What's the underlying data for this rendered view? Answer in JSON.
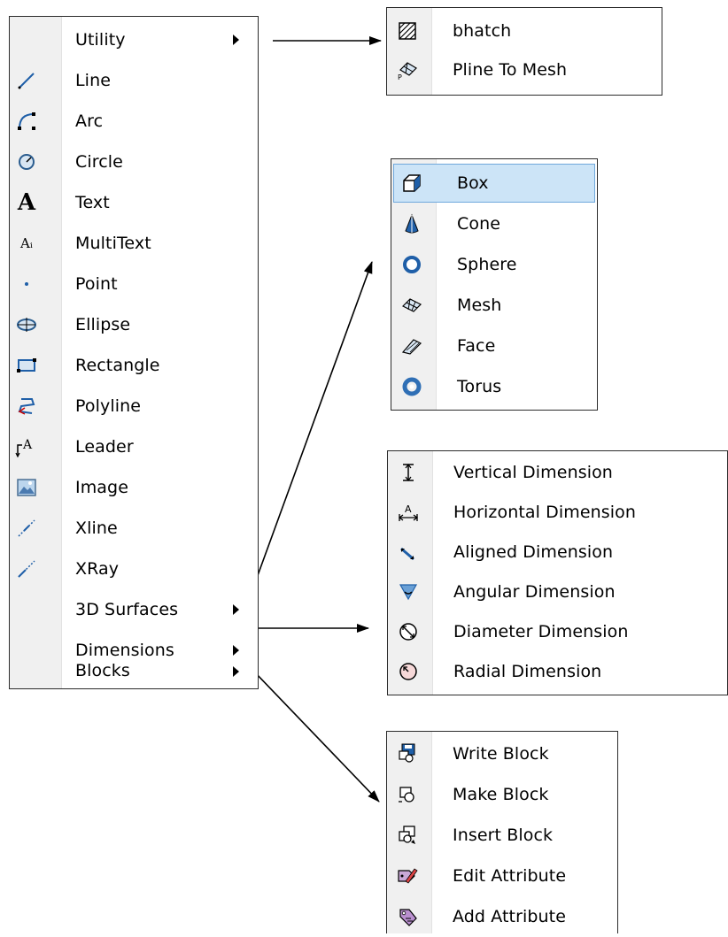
{
  "main_menu": {
    "items": [
      {
        "label": "Utility",
        "icon": "none",
        "submenu": true
      },
      {
        "label": "Line",
        "icon": "line-icon"
      },
      {
        "label": "Arc",
        "icon": "arc-icon"
      },
      {
        "label": "Circle",
        "icon": "circle-icon"
      },
      {
        "label": "Text",
        "icon": "text-icon",
        "glyph": "A"
      },
      {
        "label": "MultiText",
        "icon": "multitext-icon",
        "glyph": "Aᵢ"
      },
      {
        "label": "Point",
        "icon": "point-icon"
      },
      {
        "label": "Ellipse",
        "icon": "ellipse-icon"
      },
      {
        "label": "Rectangle",
        "icon": "rectangle-icon"
      },
      {
        "label": "Polyline",
        "icon": "polyline-icon"
      },
      {
        "label": "Leader",
        "icon": "leader-icon",
        "glyph": "A"
      },
      {
        "label": "Image",
        "icon": "image-icon"
      },
      {
        "label": "Xline",
        "icon": "xline-icon"
      },
      {
        "label": "XRay",
        "icon": "xray-icon"
      },
      {
        "label": "3D Surfaces",
        "icon": "none",
        "submenu": true
      },
      {
        "label": "Dimensions",
        "icon": "none",
        "submenu": true
      },
      {
        "label": "Blocks",
        "icon": "none",
        "submenu": true
      }
    ]
  },
  "utility_menu": {
    "items": [
      {
        "label": "bhatch",
        "icon": "hatch-icon"
      },
      {
        "label": "Pline To Mesh",
        "icon": "pline-to-mesh-icon"
      }
    ]
  },
  "surfaces_menu": {
    "items": [
      {
        "label": "Box",
        "icon": "box-icon",
        "highlighted": true
      },
      {
        "label": "Cone",
        "icon": "cone-icon"
      },
      {
        "label": "Sphere",
        "icon": "sphere-icon"
      },
      {
        "label": "Mesh",
        "icon": "mesh-icon"
      },
      {
        "label": "Face",
        "icon": "face-icon"
      },
      {
        "label": "Torus",
        "icon": "torus-icon"
      }
    ]
  },
  "dimensions_menu": {
    "items": [
      {
        "label": "Vertical Dimension",
        "icon": "vertical-dimension-icon"
      },
      {
        "label": "Horizontal Dimension",
        "icon": "horizontal-dimension-icon"
      },
      {
        "label": "Aligned Dimension",
        "icon": "aligned-dimension-icon"
      },
      {
        "label": "Angular Dimension",
        "icon": "angular-dimension-icon"
      },
      {
        "label": "Diameter Dimension",
        "icon": "diameter-dimension-icon"
      },
      {
        "label": "Radial Dimension",
        "icon": "radial-dimension-icon"
      }
    ]
  },
  "blocks_menu": {
    "items": [
      {
        "label": "Write Block",
        "icon": "write-block-icon"
      },
      {
        "label": "Make Block",
        "icon": "make-block-icon"
      },
      {
        "label": "Insert Block",
        "icon": "insert-block-icon"
      },
      {
        "label": "Edit Attribute",
        "icon": "edit-attribute-icon"
      },
      {
        "label": "Add Attribute",
        "icon": "add-attribute-icon"
      }
    ]
  },
  "colors": {
    "highlight": "#cce4f7",
    "highlight_border": "#6fa8dc",
    "icon_blue": "#1f5fa8",
    "menu_border": "#2b2b2b"
  }
}
